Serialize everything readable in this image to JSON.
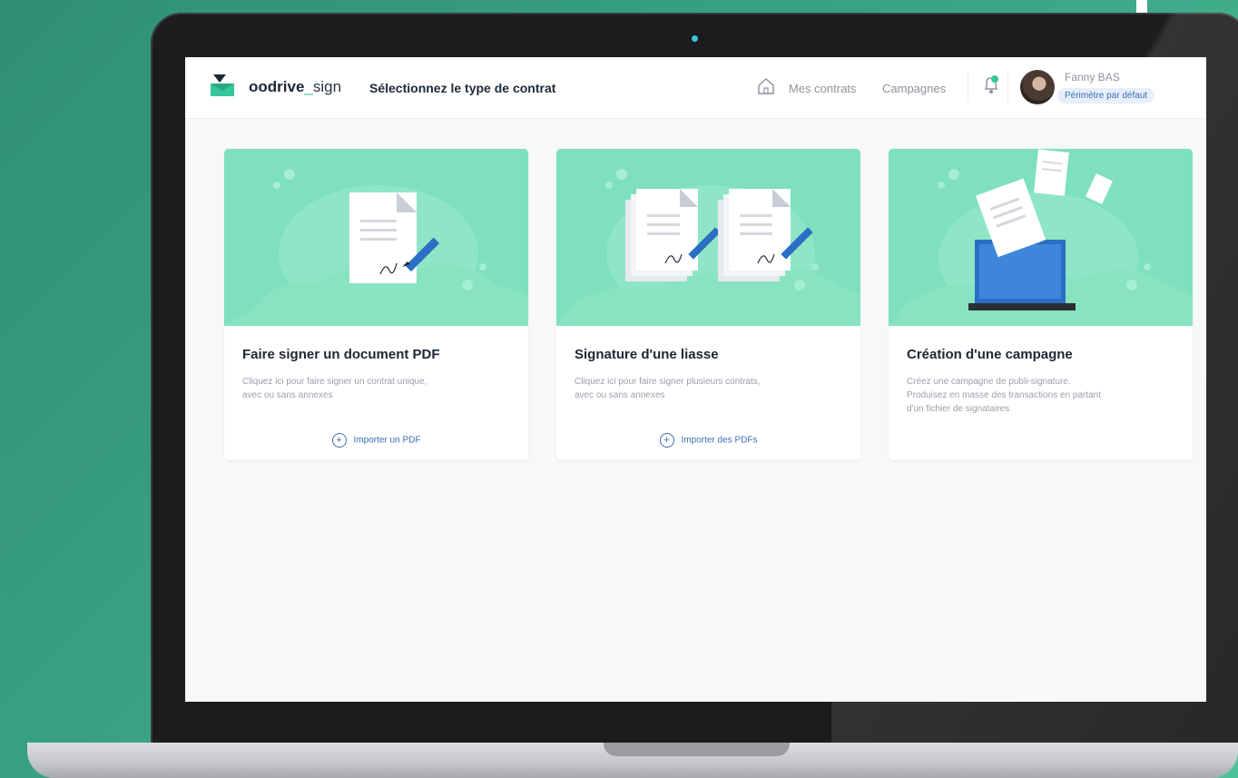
{
  "app": {
    "brand_main": "oodrive",
    "brand_sep": "_",
    "brand_sub": "sign",
    "page_title": "Sélectionnez le type de contrat"
  },
  "nav": {
    "mes_contrats": "Mes contrats",
    "campagnes": "Campagnes"
  },
  "user": {
    "name": "Fanny BAS",
    "perimeter": "Périmètre par défaut"
  },
  "cards": [
    {
      "title": "Faire signer un document PDF",
      "desc": [
        "Cliquez ici pour faire signer un contrat unique,",
        "avec ou sans annexes"
      ],
      "action": "Importer un PDF"
    },
    {
      "title": "Signature d'une liasse",
      "desc": [
        "Cliquez ici pour faire signer plusieurs contrats,",
        "avec ou sans annexes"
      ],
      "action": "Importer des PDFs"
    },
    {
      "title": "Création d'une campagne",
      "desc": [
        "Créez une campagne de publi-signature.",
        "Produisez en masse des transactions en partant",
        "d'un fichier de signataires"
      ]
    }
  ],
  "colors": {
    "accent": "#35c69a",
    "card_illustration": "#7ee0bd",
    "link": "#3a6fb0",
    "laptop_frame": "#1b1c1e"
  }
}
